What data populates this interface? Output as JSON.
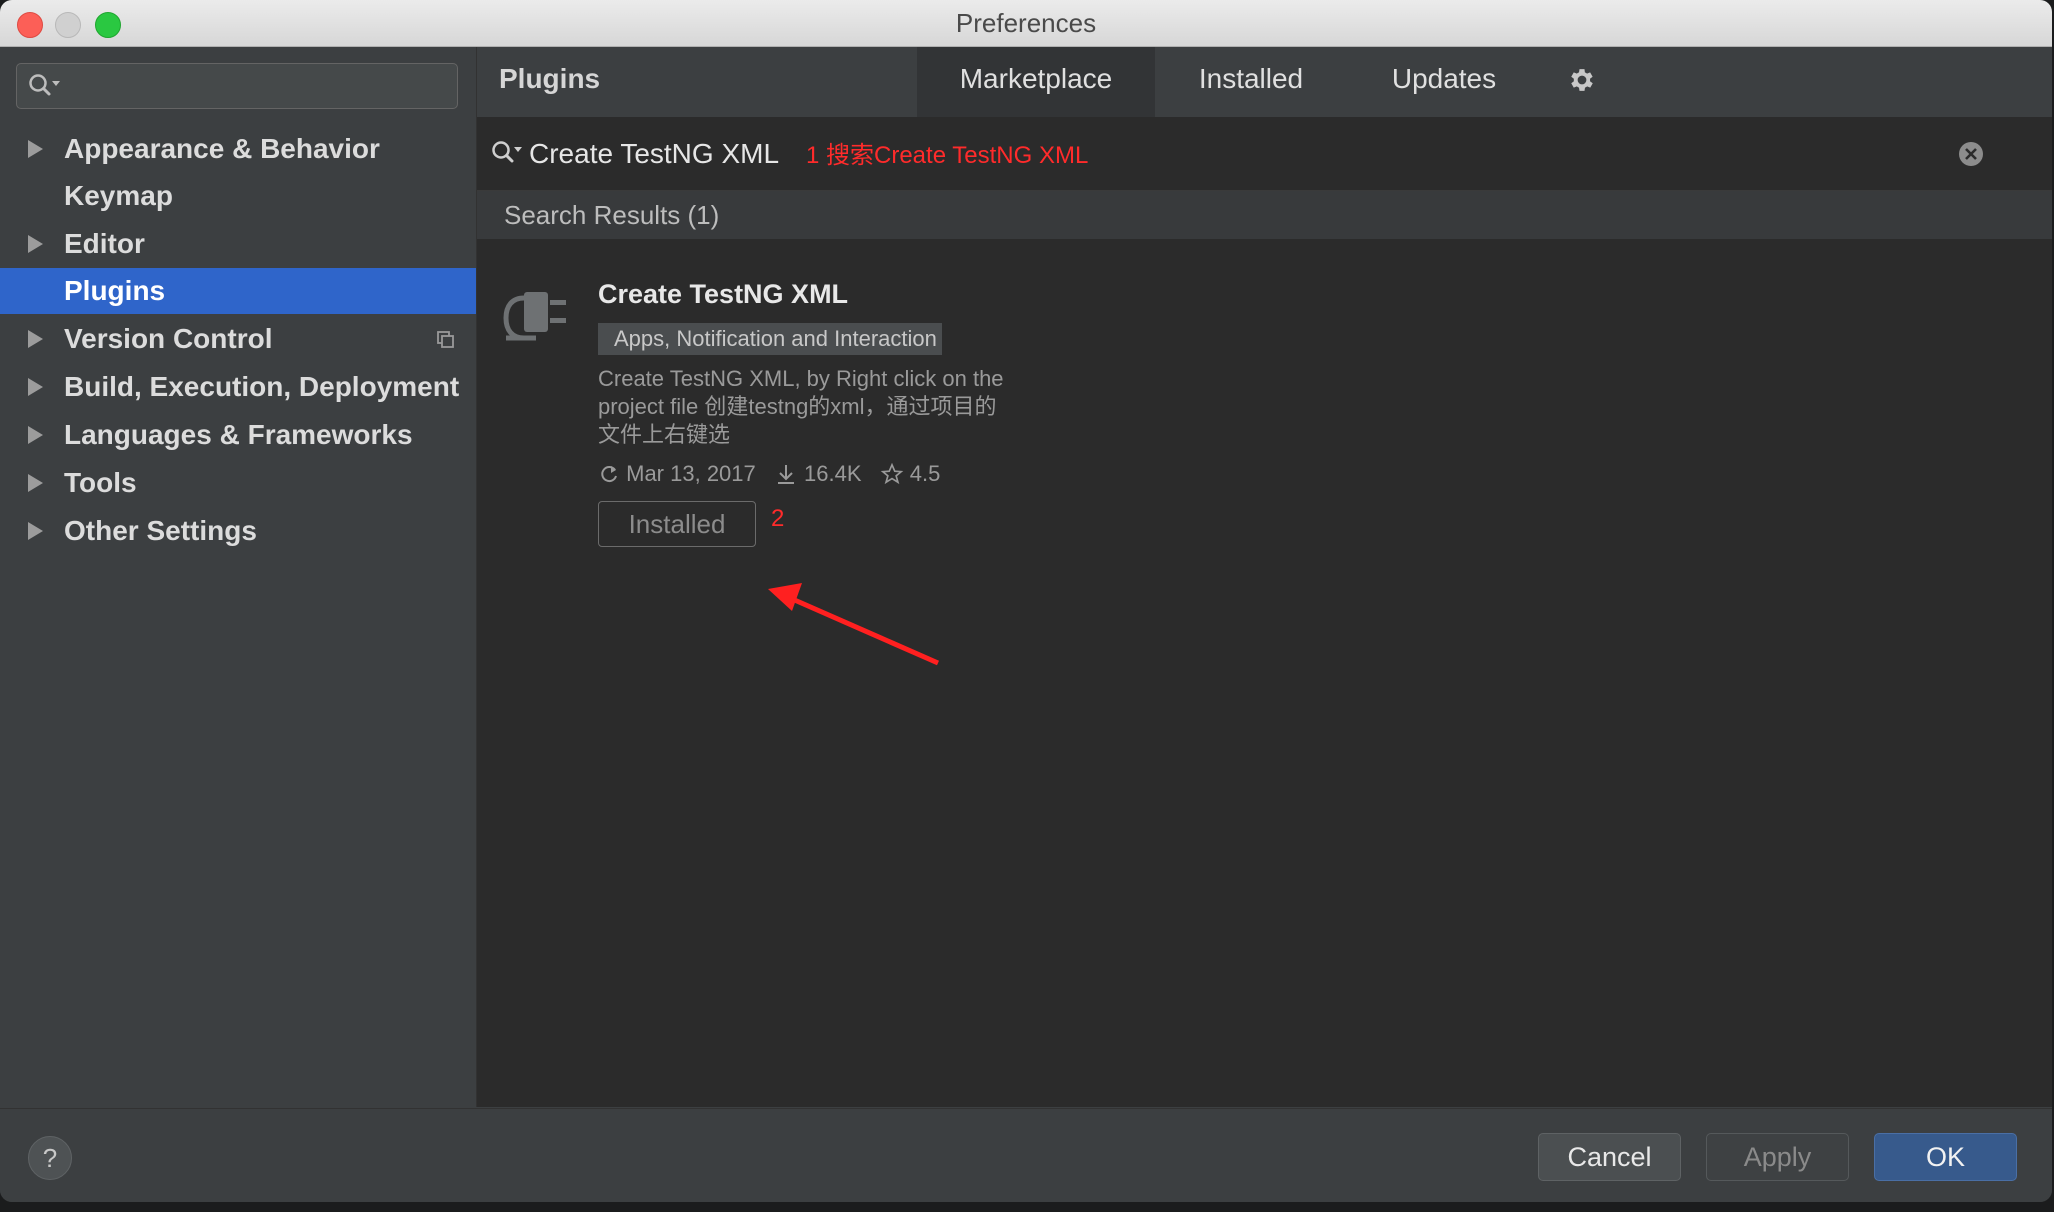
{
  "window": {
    "title": "Preferences"
  },
  "sidebar": {
    "search_placeholder": "",
    "items": [
      {
        "label": "Appearance & Behavior",
        "expandable": true
      },
      {
        "label": "Keymap",
        "expandable": false
      },
      {
        "label": "Editor",
        "expandable": true
      },
      {
        "label": "Plugins",
        "expandable": false,
        "selected": true
      },
      {
        "label": "Version Control",
        "expandable": true
      },
      {
        "label": "Build, Execution, Deployment",
        "expandable": true
      },
      {
        "label": "Languages & Frameworks",
        "expandable": true
      },
      {
        "label": "Tools",
        "expandable": true
      },
      {
        "label": "Other Settings",
        "expandable": true
      }
    ]
  },
  "plugins": {
    "title": "Plugins",
    "tabs": [
      "Marketplace",
      "Installed",
      "Updates"
    ],
    "active_tab": "Marketplace",
    "search_value": "Create TestNG XML",
    "annotation_1": "1  搜索Create TestNG XML",
    "results_label": "Search Results (1)",
    "result": {
      "name": "Create TestNG XML",
      "category": "Apps, Notification and Interaction",
      "description": "Create TestNG XML, by Right click on the project file 创建testng的xml，通过项目的文件上右键选",
      "date": "Mar 13, 2017",
      "downloads": "16.4K",
      "rating": "4.5",
      "button_label": "Installed"
    },
    "annotation_2": "2"
  },
  "footer": {
    "help_label": "?",
    "cancel_label": "Cancel",
    "apply_label": "Apply",
    "ok_label": "OK"
  },
  "colors": {
    "selection": "#2f65ca",
    "annotation": "#ff2b2b",
    "ok_button": "#375a8c"
  }
}
